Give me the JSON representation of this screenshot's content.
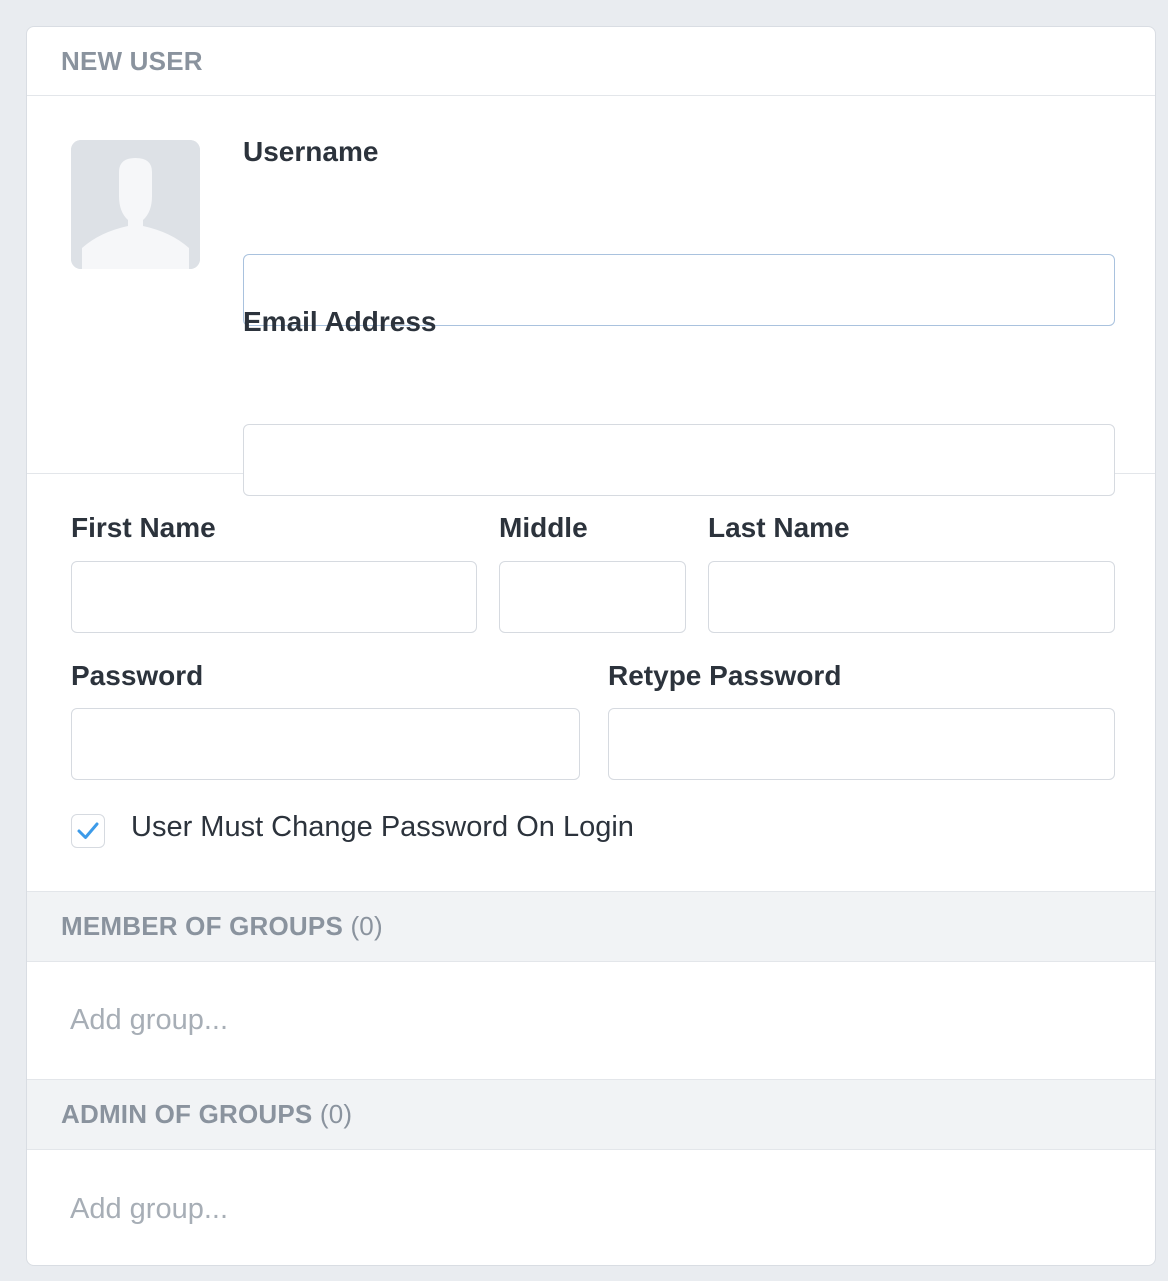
{
  "header": {
    "title": "NEW USER"
  },
  "avatar": {
    "icon": "user-silhouette-icon"
  },
  "fields": {
    "username": {
      "label": "Username",
      "value": "",
      "placeholder": ""
    },
    "email": {
      "label": "Email Address",
      "value": "",
      "placeholder": ""
    },
    "first_name": {
      "label": "First Name",
      "value": "",
      "placeholder": ""
    },
    "middle": {
      "label": "Middle",
      "value": "",
      "placeholder": ""
    },
    "last_name": {
      "label": "Last Name",
      "value": "",
      "placeholder": ""
    },
    "password": {
      "label": "Password",
      "value": "",
      "placeholder": ""
    },
    "retype_password": {
      "label": "Retype Password",
      "value": "",
      "placeholder": ""
    }
  },
  "must_change_password": {
    "label": "User Must Change Password On Login",
    "checked": true
  },
  "member_groups": {
    "title": "MEMBER OF GROUPS",
    "count": "(0)",
    "placeholder": "Add group..."
  },
  "admin_groups": {
    "title": "ADMIN OF GROUPS",
    "count": "(0)",
    "placeholder": "Add group..."
  },
  "colors": {
    "background": "#e9ecf0",
    "card": "#ffffff",
    "section_header": "#f1f3f5",
    "muted_text": "#8a939e",
    "placeholder_text": "#a7aeb6",
    "checkmark": "#3d9be9",
    "focus_border": "#a9c2de"
  }
}
